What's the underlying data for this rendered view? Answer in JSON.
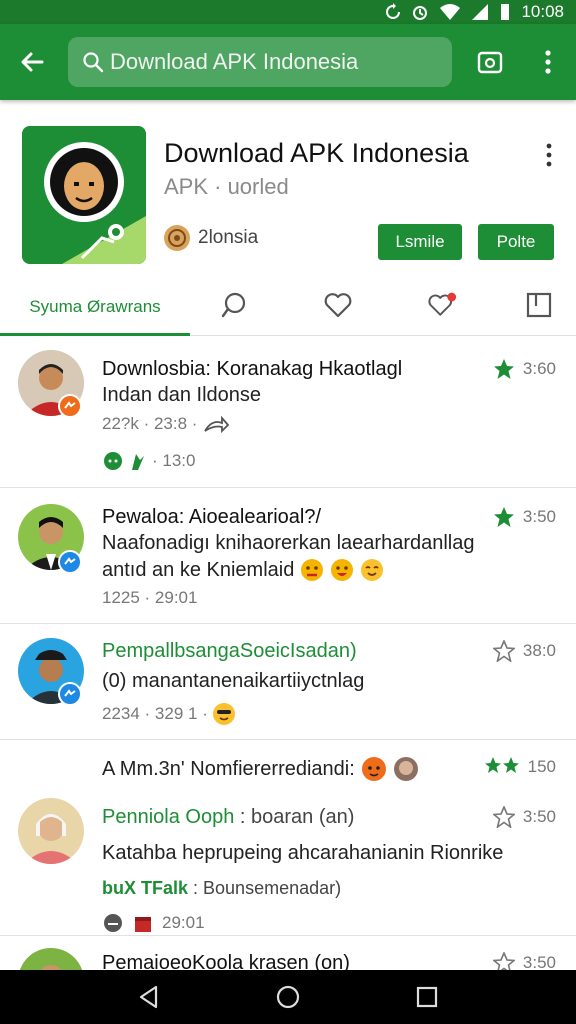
{
  "status": {
    "time": "10:08"
  },
  "appbar": {
    "search_text": "Download APK Indonesia"
  },
  "app": {
    "title": "Download APK Indonesia",
    "subtitle": "APK · uorled",
    "developer": "2lonsia",
    "button1": "Lsmile",
    "button2": "Polte"
  },
  "tabs": {
    "active_label": "Syuma Ørawrans"
  },
  "feed": [
    {
      "title": "Downlosbia: Koranakag Hkaotlagl",
      "line2": "Indan dan Ildonse",
      "meta": "22?k · 23:8 ·",
      "meta2": "· 13:0",
      "rating": "3:60"
    },
    {
      "title": "Pewaloa: Aioealearioal?/",
      "line2": "Naafonadigı knihaorerkan laearhardanllag",
      "line3": "antıd an ke Kniemlaid",
      "meta": "1225 · 29:01",
      "rating": "3:50"
    },
    {
      "title": "PempallbsangaSoeicIsadan)",
      "line2": "(0) manantanenaikartiiyctnlag",
      "meta": "2234 · 329 1 ·",
      "rating": "38:0"
    },
    {
      "section_label": "A Mm.3n' Nomfiererrediandi:",
      "section_rating": "150",
      "title": "Penniola Ooph",
      "title_suffix": ": boaran (an)",
      "line2": "Katahba heprupeing ahcarahanianin Rionrike",
      "tag": "buX TFalk",
      "tag_suffix": ": Bounsemenadar)",
      "meta": "29:01",
      "rating": "3:50"
    },
    {
      "title": "PemaioeoKoola krasen (on)",
      "rating": "3:50"
    }
  ]
}
